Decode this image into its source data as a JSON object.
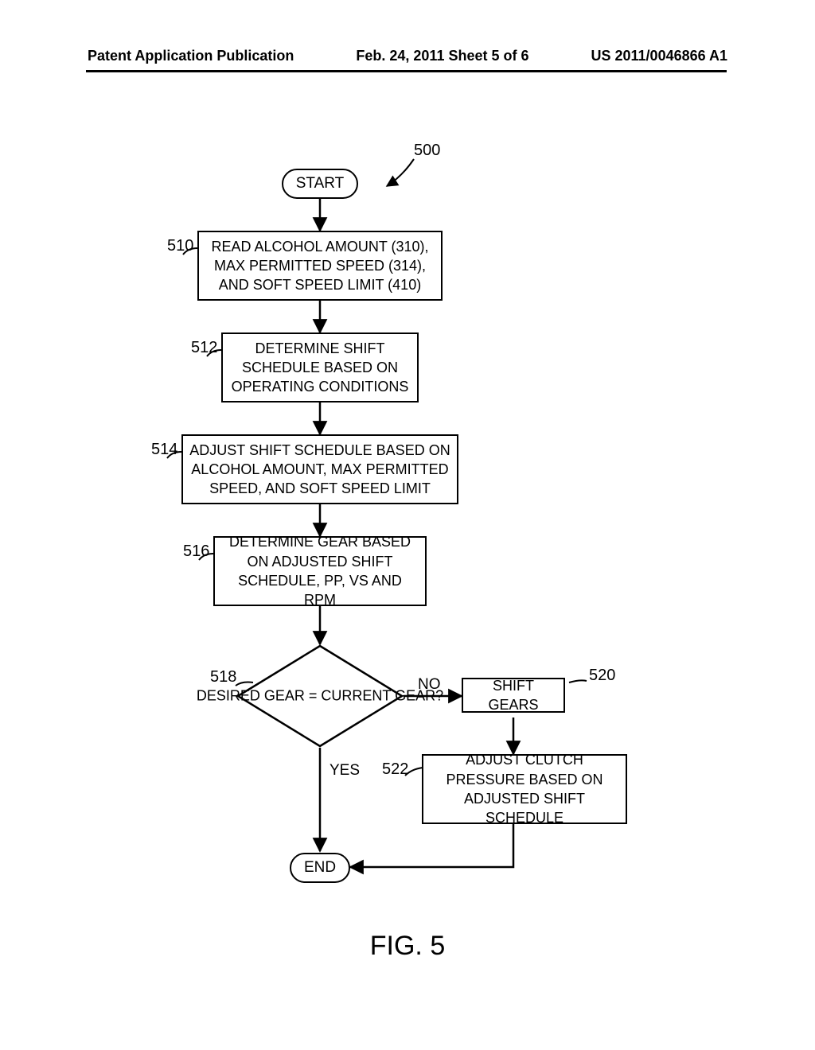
{
  "header": {
    "left": "Patent Application Publication",
    "center": "Feb. 24, 2011  Sheet 5 of 6",
    "right": "US 2011/0046866 A1"
  },
  "refs": {
    "r500": "500",
    "r510": "510",
    "r512": "512",
    "r514": "514",
    "r516": "516",
    "r518": "518",
    "r520": "520",
    "r522": "522"
  },
  "nodes": {
    "start": "START",
    "b510": "READ ALCOHOL AMOUNT (310), MAX PERMITTED SPEED (314), AND SOFT SPEED LIMIT (410)",
    "b512": "DETERMINE SHIFT SCHEDULE BASED ON OPERATING CONDITIONS",
    "b514": "ADJUST SHIFT SCHEDULE BASED ON ALCOHOL AMOUNT, MAX PERMITTED SPEED, AND SOFT SPEED LIMIT",
    "b516": "DETERMINE GEAR BASED ON ADJUSTED SHIFT SCHEDULE, PP, VS AND RPM",
    "d518": "DESIRED GEAR = CURRENT GEAR?",
    "b520": "SHIFT GEARS",
    "b522": "ADJUST CLUTCH PRESSURE BASED ON ADJUSTED SHIFT SCHEDULE",
    "end": "END"
  },
  "edges": {
    "yes": "YES",
    "no": "NO"
  },
  "figure": "FIG. 5",
  "chart_data": {
    "type": "flowchart",
    "title": "FIG. 5",
    "nodes": [
      {
        "id": "start",
        "type": "terminator",
        "label": "START"
      },
      {
        "id": "510",
        "type": "process",
        "label": "READ ALCOHOL AMOUNT (310), MAX PERMITTED SPEED (314), AND SOFT SPEED LIMIT (410)"
      },
      {
        "id": "512",
        "type": "process",
        "label": "DETERMINE SHIFT SCHEDULE BASED ON OPERATING CONDITIONS"
      },
      {
        "id": "514",
        "type": "process",
        "label": "ADJUST SHIFT SCHEDULE BASED ON ALCOHOL AMOUNT, MAX PERMITTED SPEED, AND SOFT SPEED LIMIT"
      },
      {
        "id": "516",
        "type": "process",
        "label": "DETERMINE GEAR BASED ON ADJUSTED SHIFT SCHEDULE, PP, VS AND RPM"
      },
      {
        "id": "518",
        "type": "decision",
        "label": "DESIRED GEAR = CURRENT GEAR?"
      },
      {
        "id": "520",
        "type": "process",
        "label": "SHIFT GEARS"
      },
      {
        "id": "522",
        "type": "process",
        "label": "ADJUST CLUTCH PRESSURE BASED ON ADJUSTED SHIFT SCHEDULE"
      },
      {
        "id": "end",
        "type": "terminator",
        "label": "END"
      }
    ],
    "edges": [
      {
        "from": "start",
        "to": "510"
      },
      {
        "from": "510",
        "to": "512"
      },
      {
        "from": "512",
        "to": "514"
      },
      {
        "from": "514",
        "to": "516"
      },
      {
        "from": "516",
        "to": "518"
      },
      {
        "from": "518",
        "to": "end",
        "label": "YES"
      },
      {
        "from": "518",
        "to": "520",
        "label": "NO"
      },
      {
        "from": "520",
        "to": "522"
      },
      {
        "from": "522",
        "to": "end"
      }
    ],
    "reference_numeral": "500"
  }
}
